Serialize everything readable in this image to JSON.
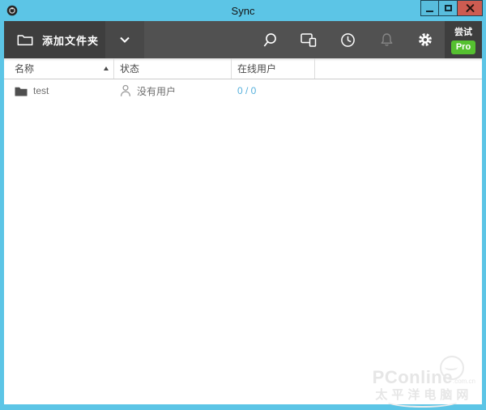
{
  "window": {
    "title": "Sync",
    "titlebar_color": "#5cc5e6",
    "close_button_color": "#cd5c51"
  },
  "toolbar": {
    "add_folder_label": "添加文件夹",
    "icon_buttons": [
      "search-icon",
      "devices-icon",
      "clock-icon",
      "bell-icon",
      "gear-icon"
    ],
    "try_label": "尝试",
    "pro_badge": "Pro",
    "pro_badge_color": "#55c030"
  },
  "table": {
    "columns": [
      "名称",
      "状态",
      "在线用户"
    ],
    "sort": {
      "column": "名称",
      "direction": "asc"
    },
    "online_link_color": "#56b0dc",
    "rows": [
      {
        "name": "test",
        "status": "没有用户",
        "online_users": "0 / 0"
      }
    ]
  },
  "watermark": {
    "brand": "PConline",
    "domain": ".com.cn",
    "subtitle": "太平洋电脑网"
  }
}
